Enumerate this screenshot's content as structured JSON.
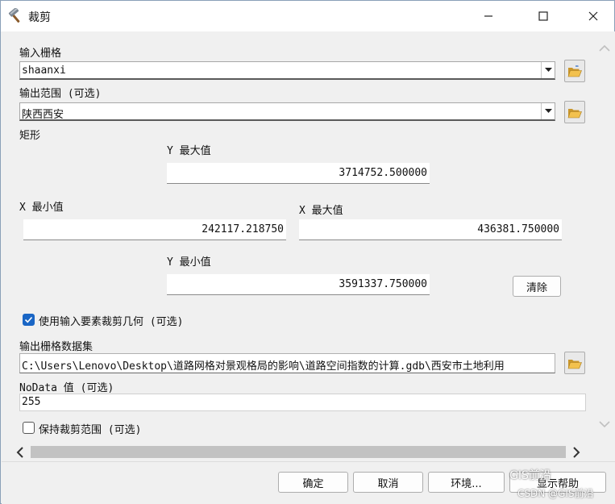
{
  "window": {
    "title": "裁剪",
    "icon": "hammer-icon"
  },
  "input_raster": {
    "label": "输入栅格",
    "value": "shaanxi"
  },
  "output_extent": {
    "label": "输出范围 (可选)",
    "value": "陕西西安"
  },
  "rectangle": {
    "label": "矩形",
    "y_max_label": "Y 最大值",
    "y_max": "3714752.500000",
    "x_min_label": "X 最小值",
    "x_min": "242117.218750",
    "x_max_label": "X 最大值",
    "x_max": "436381.750000",
    "y_min_label": "Y 最小值",
    "y_min": "3591337.750000",
    "clear_label": "清除"
  },
  "use_input_features": {
    "label": "使用输入要素裁剪几何 (可选)",
    "checked": true
  },
  "output_raster": {
    "label": "输出栅格数据集",
    "value": "C:\\Users\\Lenovo\\Desktop\\道路网格对景观格局的影响\\道路空间指数的计算.gdb\\西安市土地利用"
  },
  "nodata": {
    "label": "NoData 值 (可选)",
    "value": "255"
  },
  "maintain_extent": {
    "label": "保持裁剪范围 (可选)",
    "checked": false
  },
  "buttons": {
    "ok": "确定",
    "cancel": "取消",
    "environments": "环境...",
    "show_help": "显示帮助"
  },
  "watermark": {
    "line1": "GIS前沿",
    "line2": "CSDN @GIS前沿"
  }
}
